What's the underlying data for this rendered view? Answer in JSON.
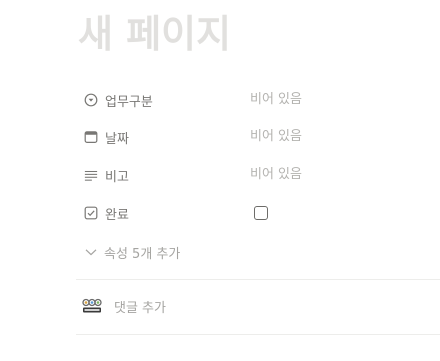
{
  "page": {
    "title": "새 페이지"
  },
  "properties": [
    {
      "label": "업무구분",
      "icon": "select-icon",
      "value": "비어 있음"
    },
    {
      "label": "날짜",
      "icon": "calendar-icon",
      "value": "비어 있음"
    },
    {
      "label": "비고",
      "icon": "text-lines-icon",
      "value": "비어 있음"
    },
    {
      "label": "완료",
      "icon": "checkbox-icon",
      "value": "",
      "checked": false
    }
  ],
  "add_properties": {
    "label": "속성 5개 추가",
    "icon": "chevron-down-icon"
  },
  "comment": {
    "placeholder": "댓글 추가",
    "avatar_icon": "avatar-icon"
  },
  "colors": {
    "title": "#e1e0de",
    "label": "#787774",
    "empty_value": "#b4b3b0",
    "divider": "#ededeb"
  }
}
